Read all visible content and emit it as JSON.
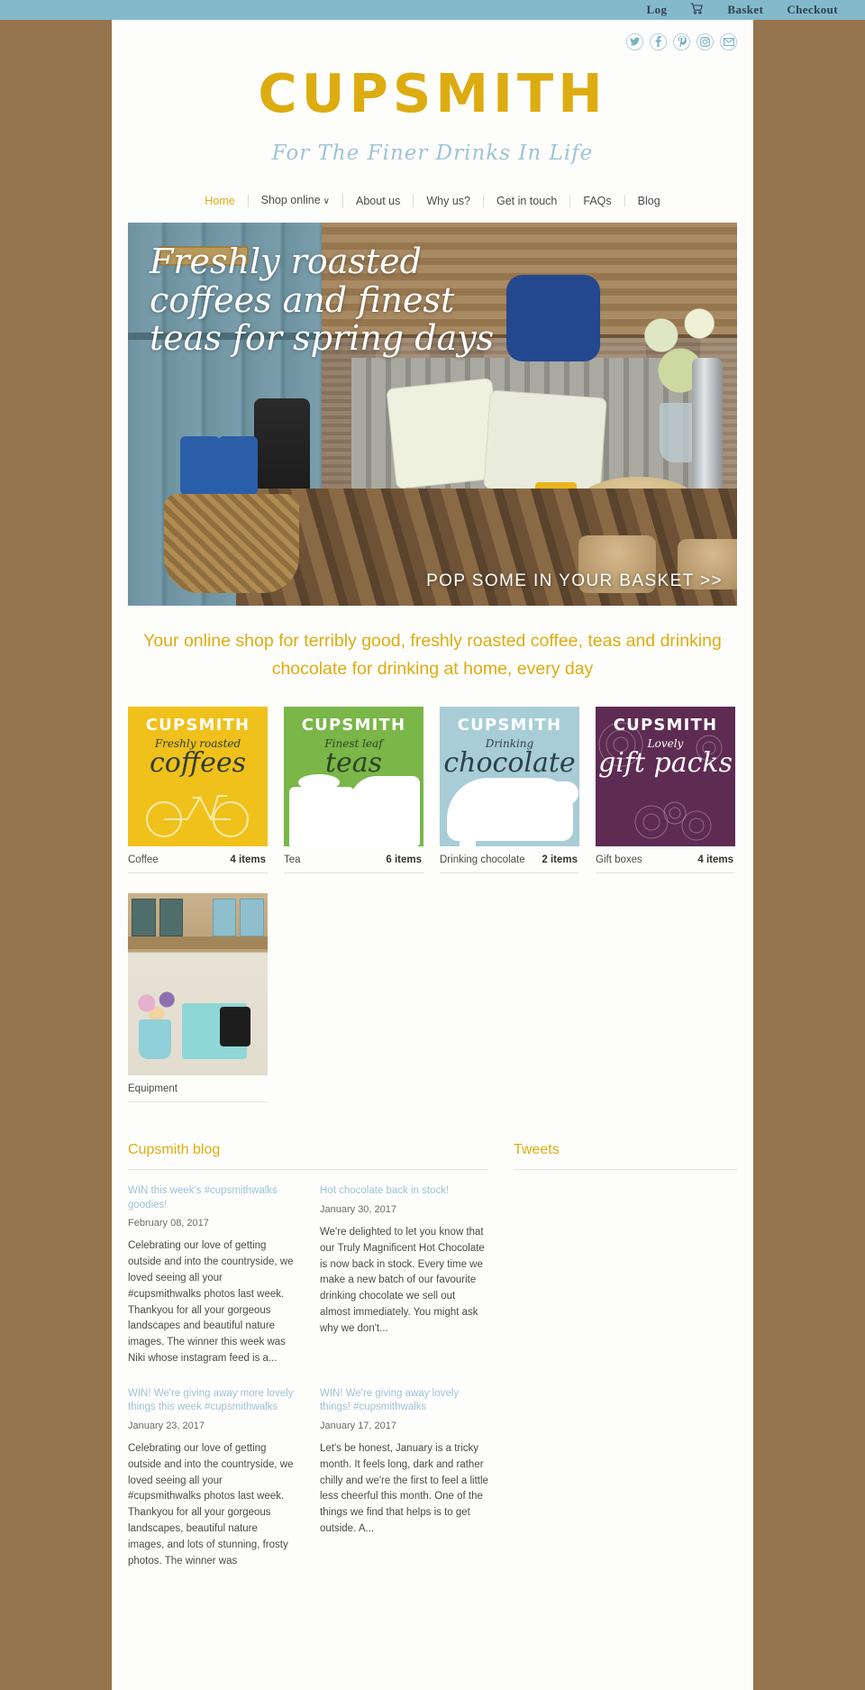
{
  "topbar": {
    "items": [
      {
        "label": "Log",
        "icon": null
      },
      {
        "label": "",
        "icon": "cart-icon"
      },
      {
        "label": "Basket",
        "icon": null
      },
      {
        "label": "Checkout",
        "icon": null
      }
    ],
    "log_label": "Log",
    "basket_label": "Basket",
    "checkout_label": "Checkout",
    "cart_glyph": "Ὥ2",
    "bg_color": "#84b9cc"
  },
  "social": [
    {
      "name": "twitter-icon",
      "glyph": "t"
    },
    {
      "name": "facebook-icon",
      "glyph": "f"
    },
    {
      "name": "pinterest-icon",
      "glyph": "p"
    },
    {
      "name": "instagram-icon",
      "glyph": "i"
    },
    {
      "name": "email-icon",
      "glyph": "✉"
    }
  ],
  "brand": {
    "name": "CUPSMITH",
    "tagline": "For The Finer Drinks In Life",
    "color": "#ddac10",
    "tagline_color": "#9ec4d4"
  },
  "nav": {
    "items": [
      {
        "label": "Home",
        "active": true,
        "caret": ""
      },
      {
        "label": "Shop online",
        "active": false,
        "caret": "∨"
      },
      {
        "label": "About us",
        "active": false,
        "caret": ""
      },
      {
        "label": "Why us?",
        "active": false,
        "caret": ""
      },
      {
        "label": "Get in touch",
        "active": false,
        "caret": ""
      },
      {
        "label": "FAQs",
        "active": false,
        "caret": ""
      },
      {
        "label": "Blog",
        "active": false,
        "caret": ""
      }
    ]
  },
  "hero": {
    "headline": "Freshly roasted coffees and finest teas for spring days",
    "cta": "POP SOME IN YOUR BASKET >>"
  },
  "strapline": "Your online shop for terribly good, freshly roasted coffee, teas and drinking chocolate for drinking at home, every day",
  "categories": [
    {
      "name": "Coffee",
      "count": "4 items",
      "brand": "CUPSMITH",
      "sub": "Freshly        roasted",
      "big": "coffees",
      "color": "#f0c11b"
    },
    {
      "name": "Tea",
      "count": "6 items",
      "brand": "CUPSMITH",
      "sub": "Finest  leaf",
      "big": "teas",
      "color": "#7ab648"
    },
    {
      "name": "Drinking chocolate",
      "count": "2 items",
      "brand": "CUPSMITH",
      "sub": "Drinking",
      "big": "chocolate",
      "color": "#a8cdd7"
    },
    {
      "name": "Gift boxes",
      "count": "4 items",
      "brand": "CUPSMITH",
      "sub": "Lovely",
      "big": "gift packs",
      "color": "#5e2b52"
    },
    {
      "name": "Equipment",
      "count": "",
      "brand": "",
      "sub": "",
      "big": "",
      "color": "#c9b38d"
    }
  ],
  "blog": {
    "title": "Cupsmith blog",
    "posts": [
      {
        "title": "WIN this week's #cupsmithwalks goodies!",
        "date": "February 08, 2017",
        "body": "Celebrating our love of getting outside and into the countryside, we loved seeing all your #cupsmithwalks photos last week. Thankyou for all your gorgeous landscapes and beautiful nature images. The winner this week was Niki whose instagram feed is a..."
      },
      {
        "title": "Hot chocolate back in stock!",
        "date": "January 30, 2017",
        "body": "We're delighted to let you know that our Truly Magnificent Hot Chocolate is now back in stock. Every time we make a new batch of our favourite drinking chocolate we sell out almost immediately. You might ask why we don't..."
      },
      {
        "title": "WIN! We're giving away more lovely things this week #cupsmithwalks",
        "date": "January 23, 2017",
        "body": "Celebrating our love of getting outside and into the countryside, we loved seeing all your #cupsmithwalks photos last week. Thankyou for all your gorgeous landscapes, beautiful nature images, and lots of stunning, frosty photos. The winner was"
      },
      {
        "title": "WIN! We're giving away lovely things! #cupsmithwalks",
        "date": "January 17, 2017",
        "body": "Let's be honest, January is a tricky month. It feels long, dark and rather chilly and we're the first to feel a little less cheerful this month. One of the things we find that helps is to get outside. A..."
      }
    ]
  },
  "tweets": {
    "title": "Tweets"
  }
}
